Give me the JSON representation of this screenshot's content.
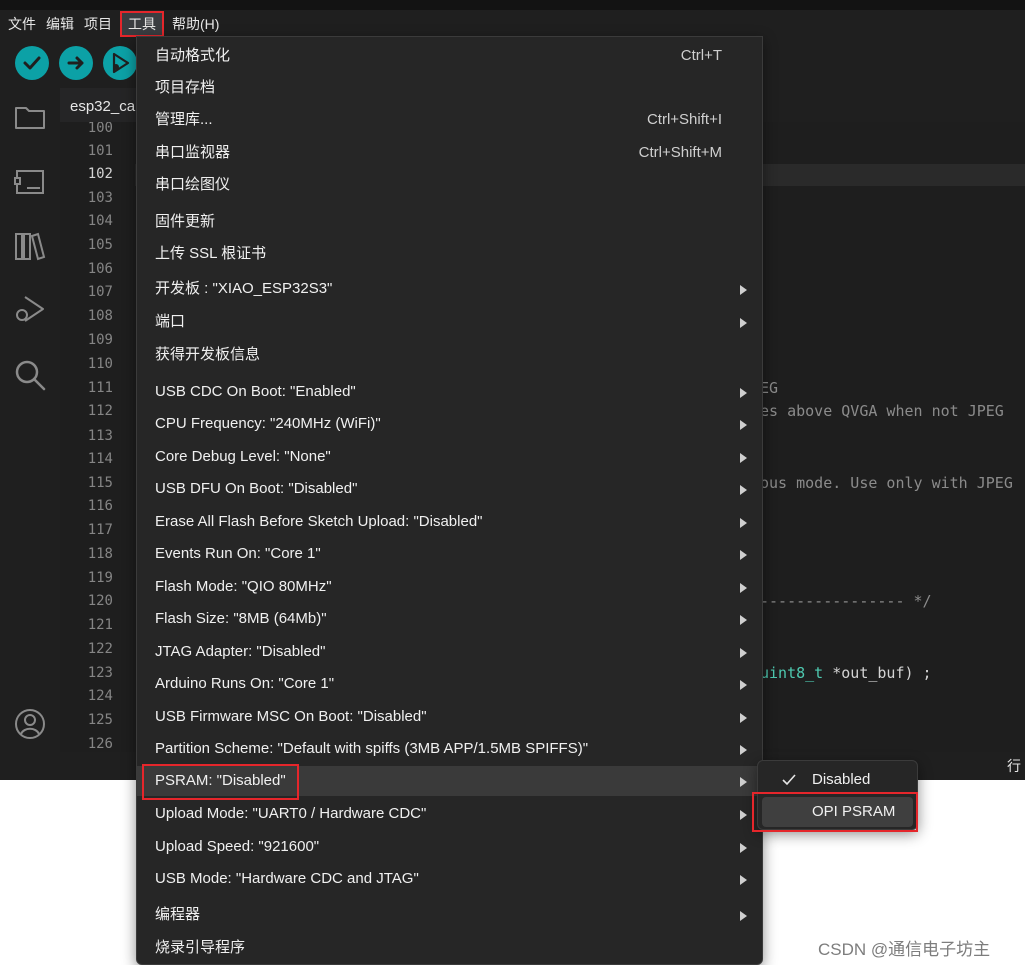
{
  "menubar": {
    "items": [
      "文件",
      "编辑",
      "项目",
      "工具",
      "帮助(H)"
    ]
  },
  "editor": {
    "tab_label": "esp32_ca",
    "line_numbers": [
      "100",
      "101",
      "102",
      "103",
      "104",
      "105",
      "106",
      "107",
      "108",
      "109",
      "110",
      "111",
      "112",
      "113",
      "114",
      "115",
      "116",
      "117",
      "118",
      "119",
      "120",
      "121",
      "122",
      "123",
      "124",
      "125",
      "126"
    ],
    "current_line": "102",
    "code_fragments": {
      "l111": "EG",
      "l112": "es above QVGA when not JPEG",
      "l115": "ous mode. Use only with JPEG",
      "l120": "---------------- */",
      "l123_type": "uint8_t",
      "l123_rest": " *out_buf) ;"
    }
  },
  "statusbar": {
    "right_text": "行"
  },
  "tools_menu": {
    "items": [
      {
        "label": "自动格式化",
        "shortcut": "Ctrl+T",
        "submenu": false
      },
      {
        "label": "项目存档",
        "shortcut": "",
        "submenu": false
      },
      {
        "label": "管理库...",
        "shortcut": "Ctrl+Shift+I",
        "submenu": false
      },
      {
        "label": "串口监视器",
        "shortcut": "Ctrl+Shift+M",
        "submenu": false
      },
      {
        "label": "串口绘图仪",
        "shortcut": "",
        "submenu": false
      },
      {
        "label": "固件更新",
        "shortcut": "",
        "submenu": false
      },
      {
        "label": "上传 SSL 根证书",
        "shortcut": "",
        "submenu": false
      },
      {
        "label": "开发板 : \"XIAO_ESP32S3\"",
        "shortcut": "",
        "submenu": true
      },
      {
        "label": "端口",
        "shortcut": "",
        "submenu": true
      },
      {
        "label": "获得开发板信息",
        "shortcut": "",
        "submenu": false
      },
      {
        "label": "USB CDC On Boot: \"Enabled\"",
        "shortcut": "",
        "submenu": true
      },
      {
        "label": "CPU Frequency: \"240MHz (WiFi)\"",
        "shortcut": "",
        "submenu": true
      },
      {
        "label": "Core Debug Level: \"None\"",
        "shortcut": "",
        "submenu": true
      },
      {
        "label": "USB DFU On Boot: \"Disabled\"",
        "shortcut": "",
        "submenu": true
      },
      {
        "label": "Erase All Flash Before Sketch Upload: \"Disabled\"",
        "shortcut": "",
        "submenu": true
      },
      {
        "label": "Events Run On: \"Core 1\"",
        "shortcut": "",
        "submenu": true
      },
      {
        "label": "Flash Mode: \"QIO 80MHz\"",
        "shortcut": "",
        "submenu": true
      },
      {
        "label": "Flash Size: \"8MB (64Mb)\"",
        "shortcut": "",
        "submenu": true
      },
      {
        "label": "JTAG Adapter: \"Disabled\"",
        "shortcut": "",
        "submenu": true
      },
      {
        "label": "Arduino Runs On: \"Core 1\"",
        "shortcut": "",
        "submenu": true
      },
      {
        "label": "USB Firmware MSC On Boot: \"Disabled\"",
        "shortcut": "",
        "submenu": true
      },
      {
        "label": "Partition Scheme: \"Default with spiffs (3MB APP/1.5MB SPIFFS)\"",
        "shortcut": "",
        "submenu": true
      },
      {
        "label": "PSRAM: \"Disabled\"",
        "shortcut": "",
        "submenu": true
      },
      {
        "label": "Upload Mode: \"UART0 / Hardware CDC\"",
        "shortcut": "",
        "submenu": true
      },
      {
        "label": "Upload Speed: \"921600\"",
        "shortcut": "",
        "submenu": true
      },
      {
        "label": "USB Mode: \"Hardware CDC and JTAG\"",
        "shortcut": "",
        "submenu": true
      },
      {
        "label": "编程器",
        "shortcut": "",
        "submenu": true
      },
      {
        "label": "烧录引导程序",
        "shortcut": "",
        "submenu": false
      }
    ]
  },
  "psram_submenu": {
    "items": [
      {
        "label": "Disabled",
        "checked": true
      },
      {
        "label": "OPI PSRAM",
        "checked": false
      }
    ]
  },
  "watermark": "CSDN @通信电子坊主",
  "colors": {
    "accent_teal": "#0ca1a6",
    "highlight_red": "#e5262b",
    "menu_bg": "#262626"
  },
  "icons": [
    "verify-icon",
    "upload-icon",
    "debug-icon",
    "folder-icon",
    "boards-icon",
    "library-icon",
    "debug-sidebar-icon",
    "search-icon",
    "account-icon",
    "chevron-right-icon",
    "check-icon"
  ]
}
